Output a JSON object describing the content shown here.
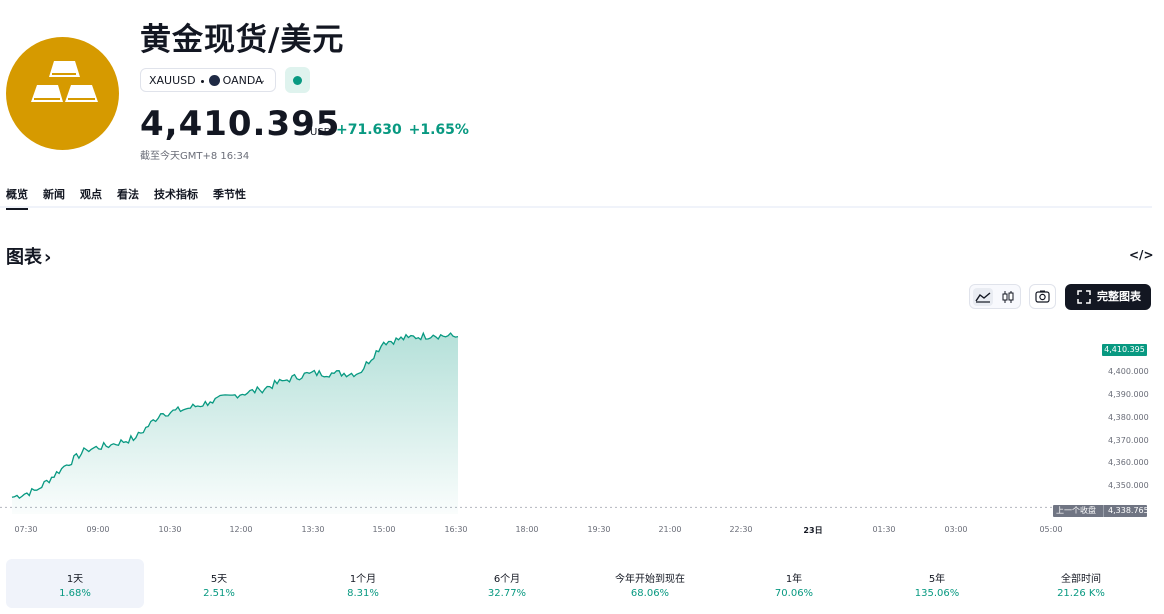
{
  "header": {
    "icon": "gold-bars-icon",
    "title": "黄金现货/美元",
    "symbol": "XAUUSD",
    "exchange": "OANDA",
    "price": "4,410.395",
    "currency": "USD",
    "change": "+71.630",
    "change_pct": "+1.65%",
    "as_of": "截至今天GMT+8 16:34",
    "market_status": "open",
    "accent": "#089981",
    "logo_color": "#d69a00"
  },
  "tabs": [
    "概览",
    "新闻",
    "观点",
    "看法",
    "技术指标",
    "季节性"
  ],
  "active_tab": 0,
  "section": {
    "title": "图表",
    "embed_icon": "code-icon"
  },
  "toolbar": {
    "full_chart_label": "完整图表",
    "area_icon": "area-chart-icon",
    "candle_icon": "candlestick-icon",
    "snapshot_icon": "camera-icon"
  },
  "chart_data": {
    "type": "area",
    "title": "",
    "x": [
      "07:30",
      "08:00",
      "08:30",
      "09:00",
      "09:30",
      "10:00",
      "10:30",
      "11:00",
      "11:30",
      "12:00",
      "12:30",
      "13:00",
      "13:30",
      "14:00",
      "14:30",
      "15:00",
      "15:30",
      "16:00",
      "16:30"
    ],
    "values": [
      4343,
      4346,
      4355,
      4363,
      4365,
      4368,
      4378,
      4380,
      4383,
      4386,
      4388,
      4392,
      4395,
      4395,
      4395,
      4408,
      4410,
      4411,
      4410.395
    ],
    "y_ticks": [
      "4,400.000",
      "4,390.000",
      "4,380.000",
      "4,370.000",
      "4,360.000",
      "4,350.000"
    ],
    "ylim": [
      4336,
      4414
    ],
    "x_ticks": [
      "07:30",
      "09:00",
      "10:30",
      "12:00",
      "13:30",
      "15:00",
      "16:30",
      "18:00",
      "19:30",
      "21:00",
      "22:30",
      "23日",
      "01:30",
      "03:00",
      "05:00"
    ],
    "bold_x_tick": "23日",
    "last_price_label": "4,410.395",
    "prev_close_label": "上一个收盘",
    "prev_close_value": "4,338.765",
    "prev_close": 4338.765,
    "line_color": "#089981"
  },
  "ranges": [
    {
      "label": "1天",
      "value": "1.68%"
    },
    {
      "label": "5天",
      "value": "2.51%"
    },
    {
      "label": "1个月",
      "value": "8.31%"
    },
    {
      "label": "6个月",
      "value": "32.77%"
    },
    {
      "label": "今年开始到现在",
      "value": "68.06%"
    },
    {
      "label": "1年",
      "value": "70.06%"
    },
    {
      "label": "5年",
      "value": "135.06%"
    },
    {
      "label": "全部时间",
      "value": "21.26 K%"
    }
  ],
  "active_range": 0
}
